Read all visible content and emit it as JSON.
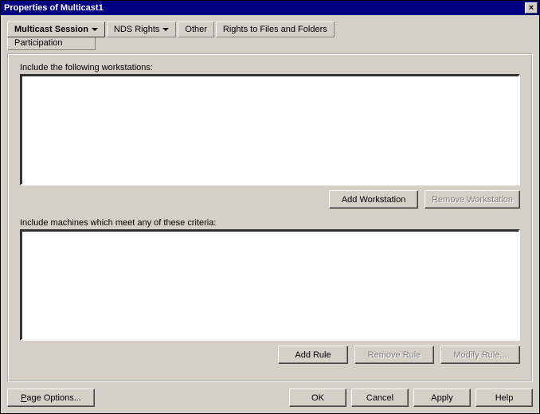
{
  "title": "Properties of Multicast1",
  "close_glyph": "×",
  "tabs": {
    "multicast_session": "Multicast Session",
    "nds_rights": "NDS Rights",
    "other": "Other",
    "rights_files_folders": "Rights to Files and Folders",
    "participation": "Participation"
  },
  "section1": {
    "label": "Include the following workstations:",
    "add_btn": "Add Workstation",
    "remove_btn": "Remove Workstation"
  },
  "section2": {
    "label": "Include machines which meet any of these criteria:",
    "add_btn": "Add Rule",
    "remove_btn": "Remove Rule",
    "modify_btn": "Modify Rule..."
  },
  "footer": {
    "page_options": "Page Options...",
    "ok": "OK",
    "cancel": "Cancel",
    "apply": "Apply",
    "help": "Help"
  }
}
